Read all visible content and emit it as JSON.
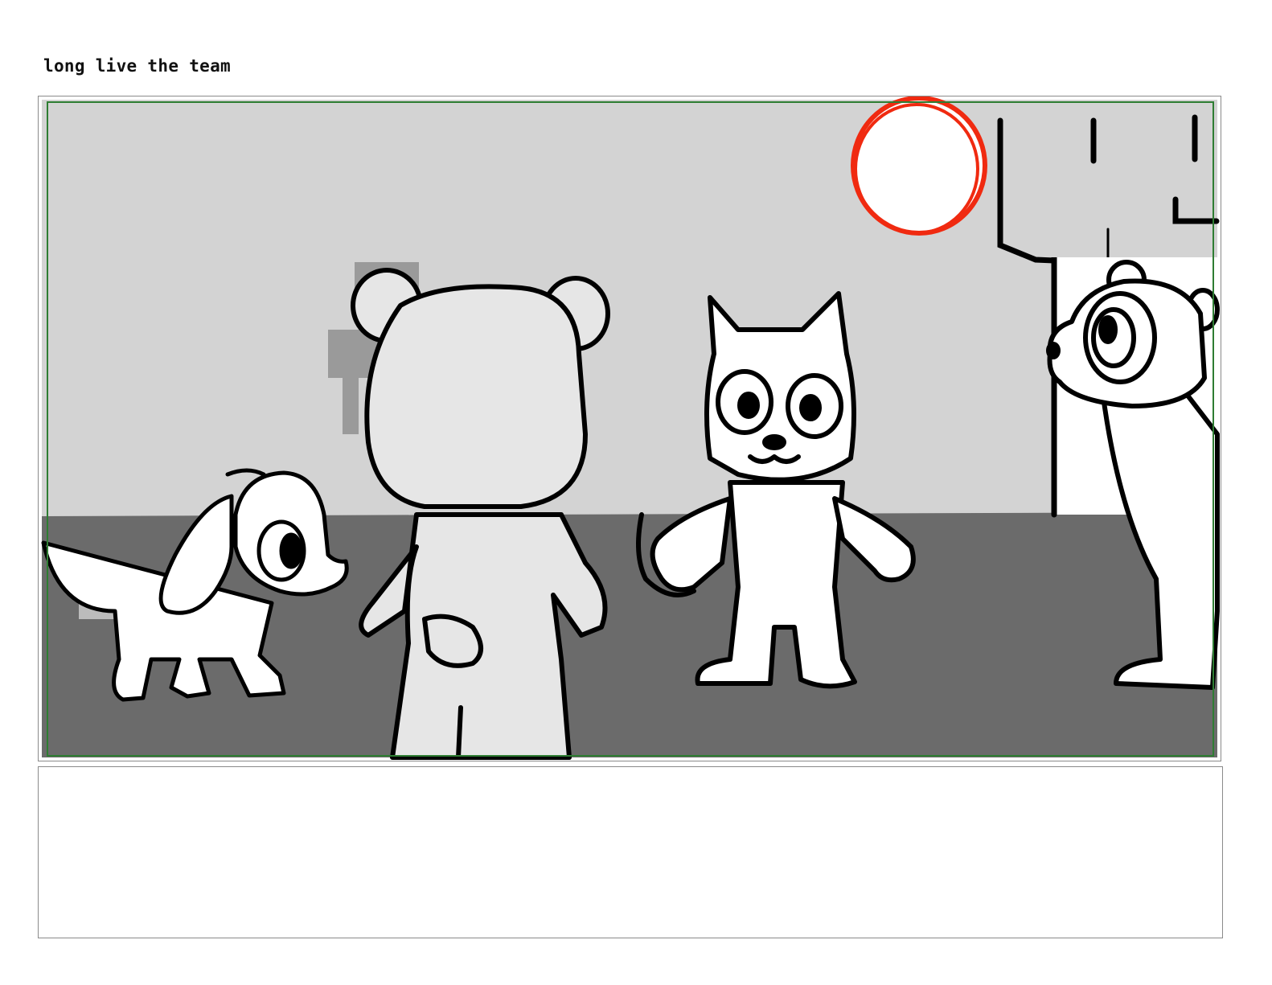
{
  "scene": {
    "title": "long live the team"
  },
  "panel": {
    "characters": [
      "puppy",
      "bear",
      "cat",
      "raccoon"
    ],
    "props": [
      "sun",
      "building"
    ]
  },
  "notes": {
    "text": ""
  },
  "colors": {
    "sky": "#d3d3d3",
    "ground": "#6b6b6b",
    "safe_area": "#2e7d32",
    "sun_outline": "#f02a10",
    "ink": "#000000",
    "character_fill": "#ffffff",
    "bear_fill": "#e6e6e6"
  }
}
